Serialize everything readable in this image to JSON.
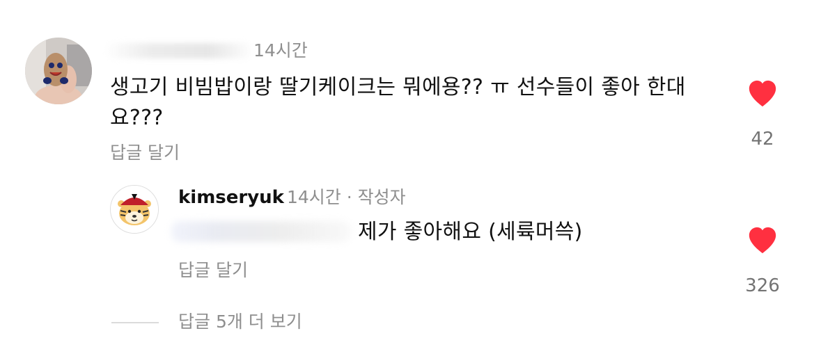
{
  "comment": {
    "username": "",
    "time": "14시간",
    "text": "생고기 비빔밥이랑 딸기케이크는 뭐에용?? ㅠ 선수들이 좋아 한대요???",
    "reply_label": "답글 달기",
    "like_count": "42",
    "avatar_icon": "person-holding-figurine-avatar",
    "like_icon": "heart-filled-icon",
    "like_color": "#ff3040"
  },
  "reply": {
    "username": "kimseryuk",
    "meta": "14시간 · 작성자",
    "mention": "",
    "text": "제가 좋아해요 (세륙머쓱)",
    "reply_label": "답글 달기",
    "like_count": "326",
    "avatar_icon": "tiger-mascot-avatar",
    "like_icon": "heart-filled-icon",
    "like_color": "#ff3040"
  },
  "view_more": {
    "label": "답글 5개 더 보기"
  }
}
